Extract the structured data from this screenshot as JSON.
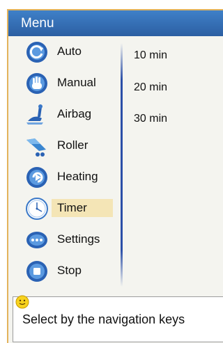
{
  "header": {
    "title": "Menu"
  },
  "menu": {
    "items": [
      {
        "label": "Auto",
        "icon": "auto-icon"
      },
      {
        "label": "Manual",
        "icon": "hand-icon"
      },
      {
        "label": "Airbag",
        "icon": "airbag-icon"
      },
      {
        "label": "Roller",
        "icon": "roller-icon"
      },
      {
        "label": "Heating",
        "icon": "heating-icon"
      },
      {
        "label": "Timer",
        "icon": "clock-icon",
        "selected": true
      },
      {
        "label": "Settings",
        "icon": "settings-icon"
      },
      {
        "label": "Stop",
        "icon": "stop-icon"
      }
    ]
  },
  "timer_options": [
    "10 min",
    "20 min",
    "30 min"
  ],
  "hint": {
    "text": "Select by the navigation keys",
    "icon": "smiley-icon"
  },
  "colors": {
    "header": "#2f6db5",
    "selected": "#f4e5b6",
    "frame_border": "#e3b35c"
  }
}
